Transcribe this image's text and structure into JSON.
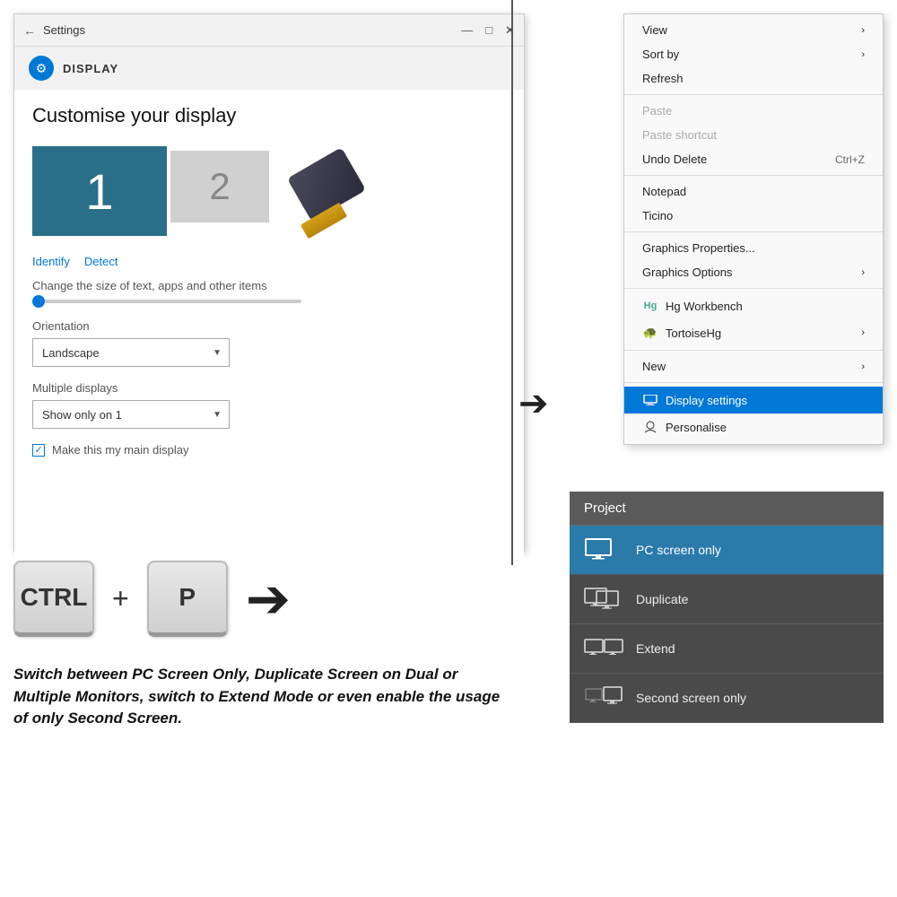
{
  "settings": {
    "title": "Settings",
    "section": "DISPLAY",
    "page_heading": "Customise your display",
    "monitor1_num": "1",
    "monitor2_num": "2",
    "identify_label": "Identify",
    "detect_label": "Detect",
    "change_size_label": "Change the size of text, apps and other items",
    "orientation_label": "Orientation",
    "orientation_value": "Landscape",
    "multiple_displays_label": "Multiple displays",
    "multiple_displays_value": "Show only on 1",
    "main_display_label": "Make this my main display"
  },
  "context_menu": {
    "items": [
      {
        "label": "View",
        "has_arrow": true,
        "disabled": false
      },
      {
        "label": "Sort by",
        "has_arrow": true,
        "disabled": false
      },
      {
        "label": "Refresh",
        "has_arrow": false,
        "disabled": false
      },
      {
        "separator": true
      },
      {
        "label": "Paste",
        "has_arrow": false,
        "disabled": true
      },
      {
        "label": "Paste shortcut",
        "has_arrow": false,
        "disabled": true
      },
      {
        "label": "Undo Delete",
        "shortcut": "Ctrl+Z",
        "has_arrow": false,
        "disabled": false
      },
      {
        "separator": true
      },
      {
        "label": "Notepad",
        "has_arrow": false,
        "disabled": false
      },
      {
        "label": "Ticino",
        "has_arrow": false,
        "disabled": false
      },
      {
        "separator": true
      },
      {
        "label": "Graphics Properties...",
        "has_arrow": false,
        "disabled": false
      },
      {
        "label": "Graphics Options",
        "has_arrow": true,
        "disabled": false
      },
      {
        "separator": true
      },
      {
        "label": "Hg Workbench",
        "icon": "hg",
        "has_arrow": false,
        "disabled": false
      },
      {
        "label": "TortoiseHg",
        "icon": "tortoise",
        "has_arrow": true,
        "disabled": false
      },
      {
        "separator": true
      },
      {
        "label": "New",
        "has_arrow": true,
        "disabled": false
      },
      {
        "separator": true
      },
      {
        "label": "Display settings",
        "icon": "display",
        "has_arrow": false,
        "disabled": false,
        "highlighted": true
      },
      {
        "label": "Personalise",
        "icon": "personalise",
        "has_arrow": false,
        "disabled": false
      }
    ]
  },
  "keyboard": {
    "ctrl_label": "CTRL",
    "plus_label": "+",
    "p_label": "P"
  },
  "description": "Switch between PC Screen Only,\nDuplicate Screen on Dual or\nMultiple Monitors, switch to\nExtend Mode or even enable\nthe usage of only Second Screen.",
  "project_panel": {
    "title": "Project",
    "items": [
      {
        "label": "PC screen only",
        "active": true
      },
      {
        "label": "Duplicate",
        "active": false
      },
      {
        "label": "Extend",
        "active": false
      },
      {
        "label": "Second screen only",
        "active": false
      }
    ]
  }
}
